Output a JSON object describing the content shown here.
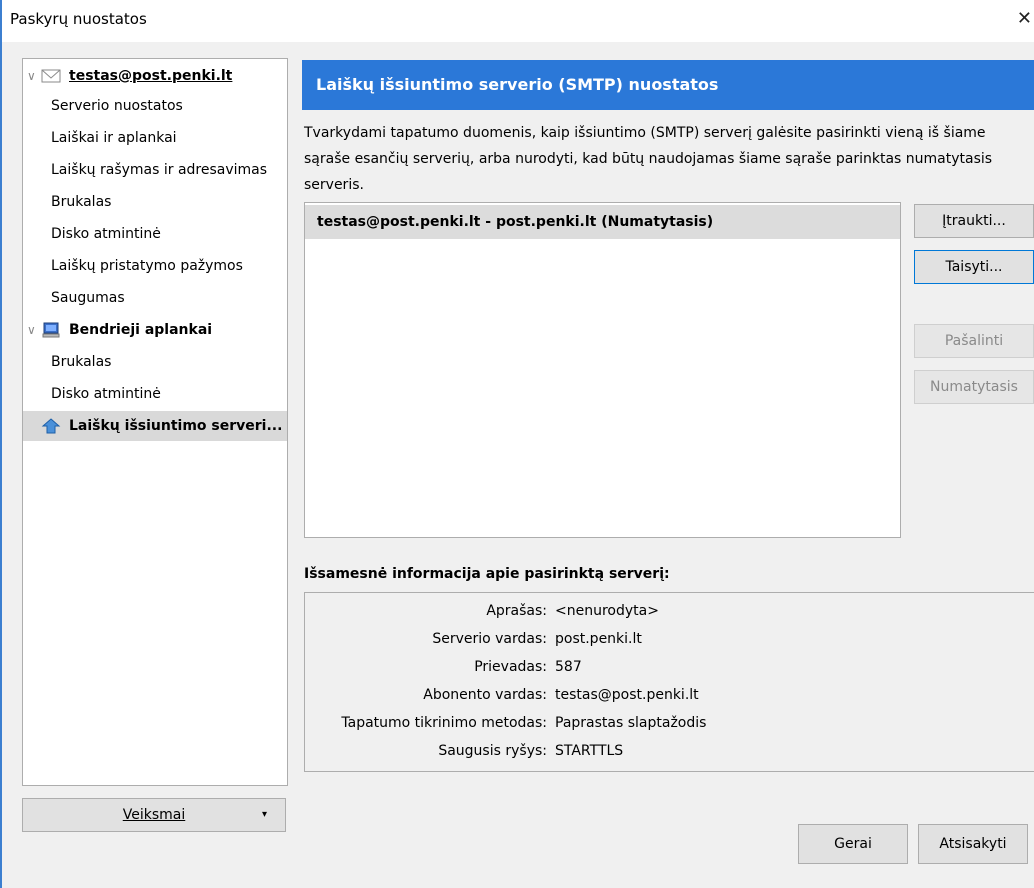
{
  "window": {
    "title": "Paskyrų nuostatos",
    "close_glyph": "✕"
  },
  "tree": {
    "account": {
      "label": "testas@post.penki.lt",
      "icon": "envelope-icon"
    },
    "account_items": [
      "Serverio nuostatos",
      "Laiškai ir aplankai",
      "Laiškų rašymas ir adresavimas",
      "Brukalas",
      "Disko atmintinė",
      "Laiškų pristatymo pažymos",
      "Saugumas"
    ],
    "local": {
      "label": "Bendrieji aplankai",
      "icon": "computer-icon"
    },
    "local_items": [
      "Brukalas",
      "Disko atmintinė"
    ],
    "smtp": {
      "label": "Laiškų išsiuntimo serveri...",
      "icon": "outgoing-server-icon"
    }
  },
  "actions": {
    "label": "Veiksmai",
    "arrow": "▾"
  },
  "panel": {
    "header": "Laiškų išsiuntimo serverio (SMTP) nuostatos",
    "description": "Tvarkydami tapatumo duomenis, kaip išsiuntimo (SMTP) serverį galėsite pasirinkti vieną iš šiame sąraše esančių serverių, arba nurodyti, kad būtų naudojamas šiame sąraše parinktas numatytasis serveris.",
    "servers": [
      "testas@post.penki.lt - post.penki.lt (Numatytasis)"
    ],
    "buttons": {
      "add": "Įtraukti...",
      "edit": "Taisyti...",
      "remove": "Pašalinti",
      "set_default": "Numatytasis"
    },
    "details_title": "Išsamesnė informacija apie pasirinktą serverį:",
    "details": [
      {
        "label": "Aprašas:",
        "value": "<nenurodyta>"
      },
      {
        "label": "Serverio vardas:",
        "value": "post.penki.lt"
      },
      {
        "label": "Prievadas:",
        "value": "587"
      },
      {
        "label": "Abonento vardas:",
        "value": "testas@post.penki.lt"
      },
      {
        "label": "Tapatumo tikrinimo metodas:",
        "value": "Paprastas slaptažodis"
      },
      {
        "label": "Saugusis ryšys:",
        "value": "STARTTLS"
      }
    ]
  },
  "footer": {
    "ok": "Gerai",
    "cancel": "Atsisakyti"
  },
  "colors": {
    "accent": "#2b78d8",
    "selection": "#d9d9d9"
  }
}
